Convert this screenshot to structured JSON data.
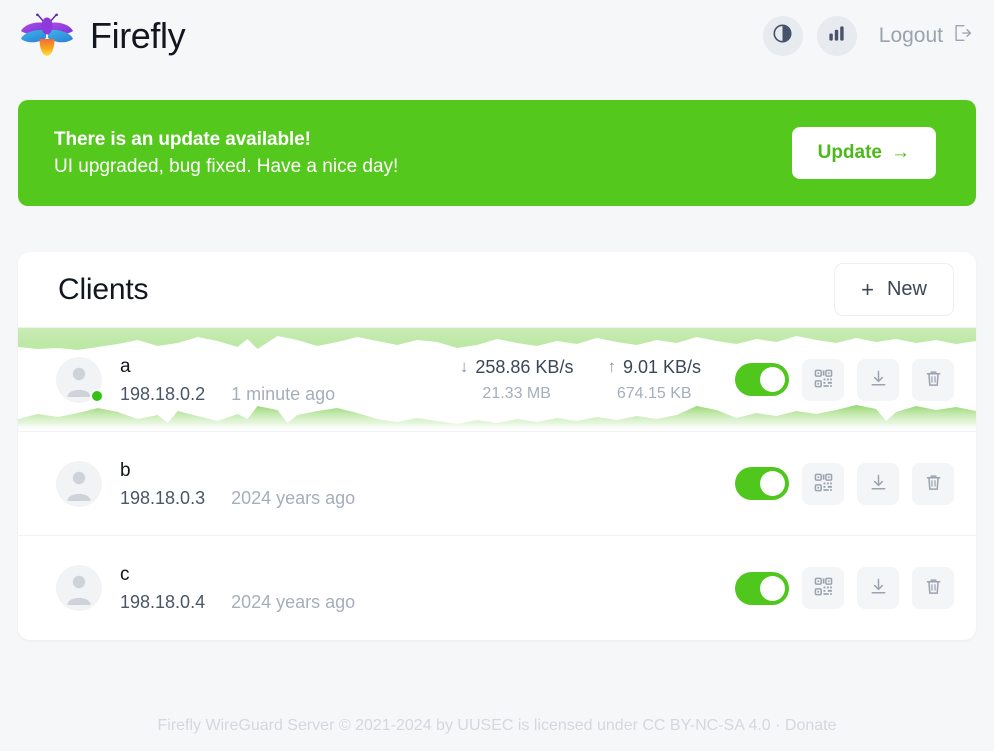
{
  "header": {
    "brand_name": "Firefly",
    "logo_icon": "firefly-logo-icon",
    "theme_toggle_icon": "contrast-circle-icon",
    "stats_icon": "bar-chart-icon",
    "logout_label": "Logout",
    "logout_icon": "sign-out-icon"
  },
  "banner": {
    "title": "There is an update available!",
    "subtitle": "UI upgraded, bug fixed. Have a nice day!",
    "button_label": "Update",
    "button_arrow": "→",
    "bg_color": "#55c81e",
    "button_text_color": "#4cb81b"
  },
  "clients_card": {
    "title": "Clients",
    "new_button_label": "New",
    "new_button_plus": "+",
    "rows": [
      {
        "name": "a",
        "ip": "198.18.0.2",
        "last_seen": "1 minute ago",
        "online": true,
        "download_rate": "258.86 KB/s",
        "download_total": "21.33 MB",
        "download_arrow": "↓",
        "upload_rate": "9.01 KB/s",
        "upload_total": "674.15 KB",
        "upload_arrow": "↑",
        "enabled": true
      },
      {
        "name": "b",
        "ip": "198.18.0.3",
        "last_seen": "2024 years ago",
        "online": false,
        "enabled": true
      },
      {
        "name": "c",
        "ip": "198.18.0.4",
        "last_seen": "2024 years ago",
        "online": false,
        "enabled": true
      }
    ],
    "row_actions": {
      "qr_icon": "qr-code-icon",
      "download_icon": "download-icon",
      "delete_icon": "trash-icon",
      "toggle_icon": "enable-toggle"
    }
  },
  "footer": {
    "text": "Firefly WireGuard Server © 2021-2024 by UUSEC is licensed under CC BY-NC-SA 4.0 · Donate"
  },
  "colors": {
    "accent_green": "#55c81e",
    "toggle_green": "#4fc71c",
    "status_dot": "#35c015",
    "page_bg": "#f6f7f9"
  }
}
